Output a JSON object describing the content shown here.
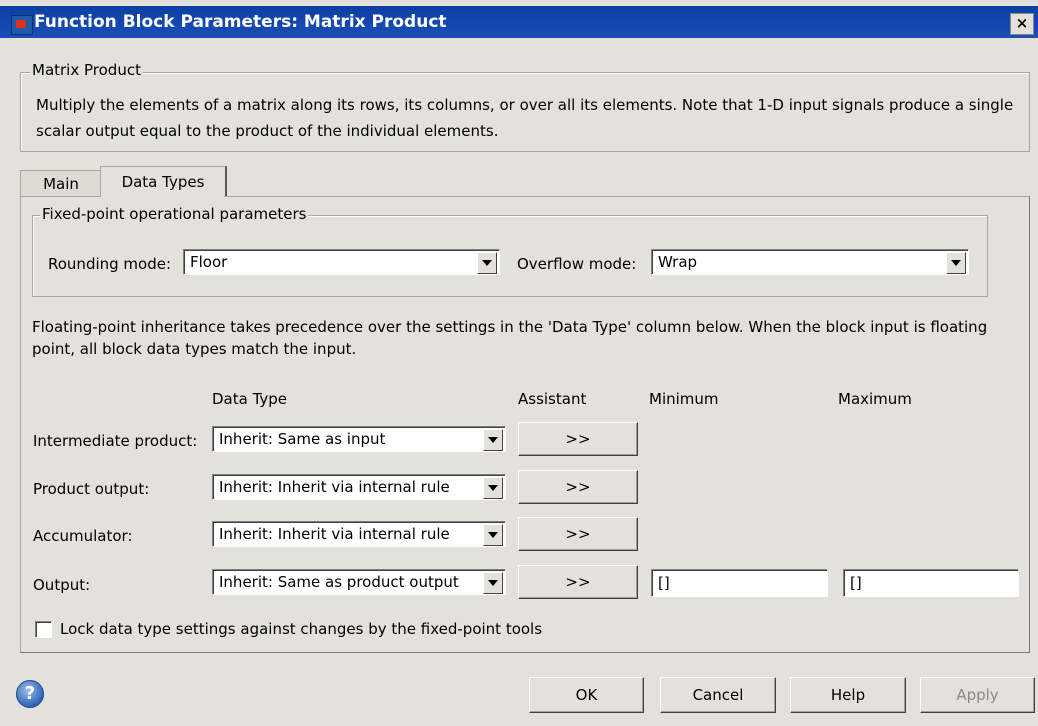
{
  "window": {
    "title": "Function Block Parameters: Matrix Product",
    "close_glyph": "×"
  },
  "block_group": {
    "label": "Matrix Product",
    "description": "Multiply the elements of a matrix along its rows, its columns, or over all its elements. Note that 1-D input signals produce a single scalar output equal to the product of the individual elements."
  },
  "tabs": [
    {
      "label": "Main",
      "selected": false
    },
    {
      "label": "Data Types",
      "selected": true
    }
  ],
  "fixed_point": {
    "group_label": "Fixed-point operational parameters",
    "rounding_label": "Rounding mode:",
    "rounding_value": "Floor",
    "overflow_label": "Overflow mode:",
    "overflow_value": "Wrap"
  },
  "inheritance_note": "Floating-point inheritance takes precedence over the settings in the 'Data Type' column below. When the block input is floating point, all block data types match the input.",
  "columns": {
    "data_type": "Data Type",
    "assistant": "Assistant",
    "minimum": "Minimum",
    "maximum": "Maximum"
  },
  "rows": [
    {
      "label": "Intermediate product:",
      "value": "Inherit: Same as input",
      "assistant": ">>"
    },
    {
      "label": "Product output:",
      "value": "Inherit: Inherit via internal rule",
      "assistant": ">>"
    },
    {
      "label": "Accumulator:",
      "value": "Inherit: Inherit via internal rule",
      "assistant": ">>"
    },
    {
      "label": "Output:",
      "value": "Inherit: Same as product output",
      "assistant": ">>",
      "minimum": "[]",
      "maximum": "[]"
    }
  ],
  "lock_checkbox": {
    "label": "Lock data type settings against changes by the fixed-point tools",
    "checked": false
  },
  "buttons": {
    "ok": "OK",
    "cancel": "Cancel",
    "help": "Help",
    "apply": "Apply"
  },
  "help_icon": "?"
}
